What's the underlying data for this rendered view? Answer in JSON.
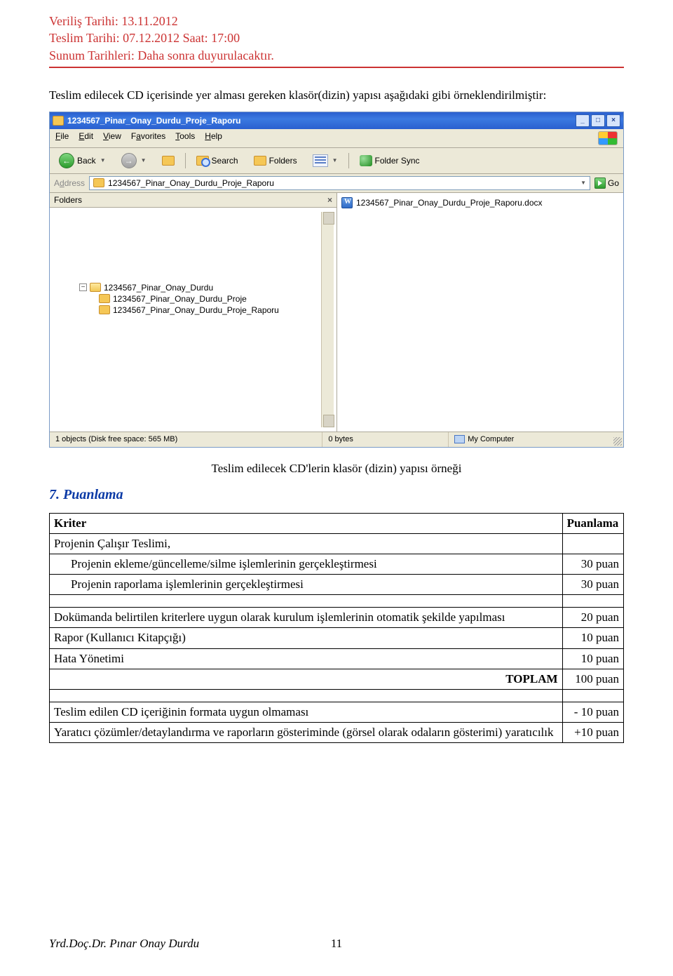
{
  "header": {
    "line1": "Veriliş Tarihi: 13.11.2012",
    "line2": "Teslim Tarihi: 07.12.2012 Saat: 17:00",
    "line3": "Sunum Tarihleri: Daha sonra duyurulacaktır."
  },
  "intro": "Teslim edilecek CD içerisinde yer alması gereken klasör(dizin) yapısı aşağıdaki gibi örneklendirilmiştir:",
  "explorer": {
    "title": "1234567_Pinar_Onay_Durdu_Proje_Raporu",
    "menu": {
      "file": "File",
      "edit": "Edit",
      "view": "View",
      "favorites": "Favorites",
      "tools": "Tools",
      "help": "Help"
    },
    "toolbar": {
      "back": "Back",
      "search": "Search",
      "folders": "Folders",
      "foldersync": "Folder Sync"
    },
    "address": {
      "label": "Address",
      "value": "1234567_Pinar_Onay_Durdu_Proje_Raporu",
      "go": "Go"
    },
    "folderspane": {
      "title": "Folders",
      "tree": {
        "root": "1234567_Pinar_Onay_Durdu",
        "child1": "1234567_Pinar_Onay_Durdu_Proje",
        "child2": "1234567_Pinar_Onay_Durdu_Proje_Raporu"
      }
    },
    "contents": {
      "file1": "1234567_Pinar_Onay_Durdu_Proje_Raporu.docx"
    },
    "status": {
      "objects": "1 objects (Disk free space: 565 MB)",
      "size": "0 bytes",
      "location": "My Computer"
    }
  },
  "caption": "Teslim edilecek CD'lerin klasör (dizin) yapısı örneği",
  "sectionHeading": "7. Puanlama",
  "table": {
    "headKriter": "Kriter",
    "headPuan": "Puanlama",
    "r1": "Projenin Çalışır Teslimi,",
    "r2": "Projenin ekleme/güncelleme/silme işlemlerinin gerçekleştirmesi",
    "r2p": "30 puan",
    "r3": "Projenin raporlama işlemlerinin gerçekleştirmesi",
    "r3p": "30 puan",
    "r4": "Dokümanda belirtilen kriterlere uygun olarak kurulum işlemlerinin otomatik şekilde yapılması",
    "r4p": "20 puan",
    "r5": "Rapor (Kullanıcı Kitapçığı)",
    "r5p": "10 puan",
    "r6": "Hata Yönetimi",
    "r6p": "10 puan",
    "rTotL": "TOPLAM",
    "rTotR": "100 puan",
    "r7": "Teslim edilen CD içeriğinin formata uygun olmaması",
    "r7p": "- 10 puan",
    "r8": "Yaratıcı çözümler/detaylandırma ve raporların gösteriminde (görsel olarak odaların gösterimi) yaratıcılık",
    "r8p": "+10 puan"
  },
  "footer": {
    "author": "Yrd.Doç.Dr. Pınar Onay Durdu",
    "page": "11"
  }
}
